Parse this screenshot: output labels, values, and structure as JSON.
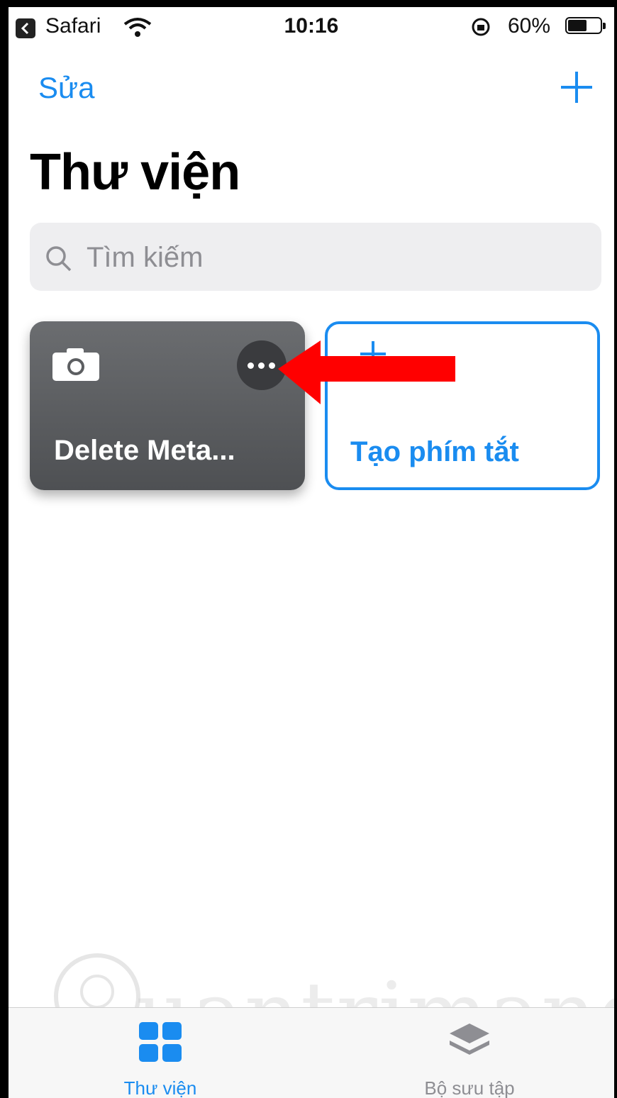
{
  "status_bar": {
    "back_app": "Safari",
    "time": "10:16",
    "battery_percent": "60%",
    "battery_level": 0.6
  },
  "nav": {
    "edit_label": "Sửa",
    "add_icon": "plus-icon"
  },
  "page": {
    "title": "Thư viện"
  },
  "search": {
    "placeholder": "Tìm kiếm"
  },
  "shortcuts": [
    {
      "name": "Delete Meta...",
      "icon": "camera-icon",
      "color": "#5c5e61"
    }
  ],
  "create_card": {
    "label": "Tạo phím tắt"
  },
  "tab_bar": {
    "tabs": [
      {
        "label": "Thư viện",
        "icon": "grid-icon",
        "selected": true
      },
      {
        "label": "Bộ sưu tập",
        "icon": "layers-icon",
        "selected": false
      }
    ]
  },
  "colors": {
    "accent": "#1a8cf0",
    "arrow": "#ff0000"
  },
  "watermark": {
    "text": "uantrimang"
  }
}
